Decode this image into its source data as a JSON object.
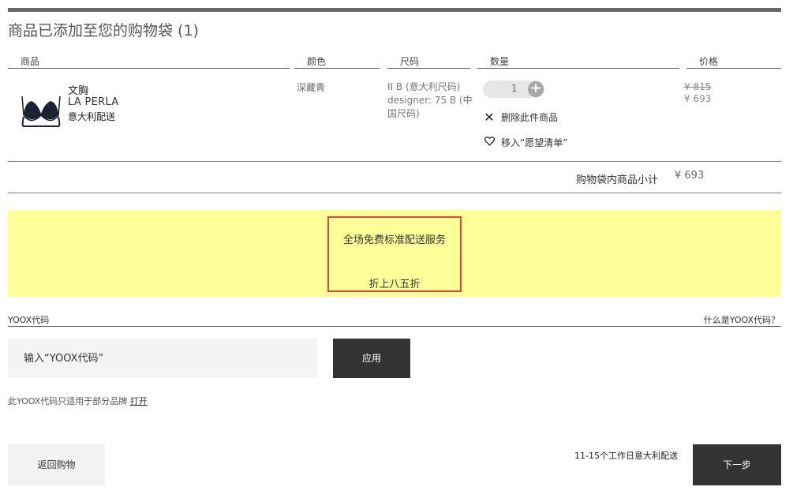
{
  "page": {
    "title": "商品已添加至您的购物袋 (1)"
  },
  "columns": {
    "product": "商品",
    "color": "颜色",
    "size": "尺码",
    "quantity": "数量",
    "price": "价格"
  },
  "item": {
    "name": "文胸",
    "brand": "LA PERLA",
    "shipping": "意大利配送",
    "color": "深藏青",
    "size_lines": [
      "II B (意大利尺码)",
      "designer: 75 B (中",
      "国尺码)"
    ],
    "quantity": "1",
    "plus_symbol": "+",
    "remove_label": "删除此件商品",
    "wishlist_label": "移入“愿望清单”",
    "price_original": "¥ 815",
    "price_current": "¥ 693"
  },
  "subtotal": {
    "label": "购物袋内商品小计",
    "value": "¥ 693"
  },
  "promo": {
    "line1": "全场免费标准配送服务",
    "line2": "折上八五折",
    "background_color": "#ffff99",
    "border_color": "#e0453a"
  },
  "code": {
    "label": "YOOX代码",
    "help_link": "什么是YOOX代码？",
    "placeholder": "输入“YOOX代码”",
    "apply_label": "应用",
    "note_text": "此YOOX代码只适用于部分品牌 ",
    "note_link": "打开"
  },
  "footer": {
    "back_label": "返回购物",
    "delivery_note": "11-15个工作日意大利配送",
    "next_label": "下一步"
  },
  "icons": {
    "remove": "close-icon",
    "wishlist": "heart-icon",
    "quantity_add": "plus-icon"
  }
}
